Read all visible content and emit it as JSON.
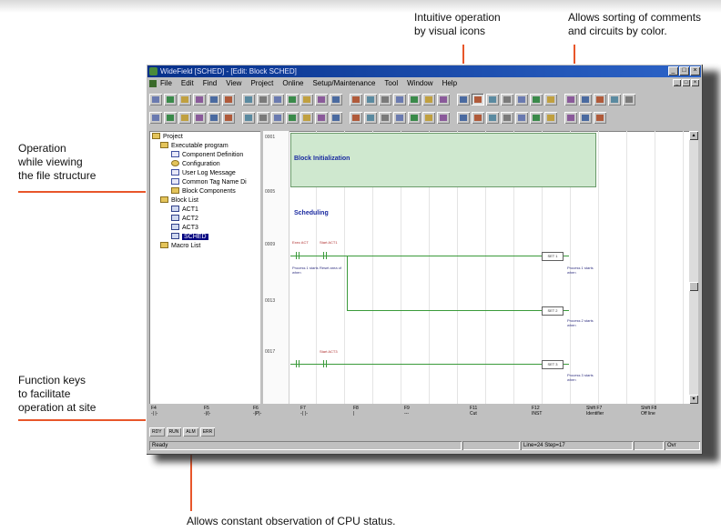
{
  "callouts": {
    "icons": "Intuitive operation\nby visual icons",
    "icons_l1": "Intuitive operation",
    "icons_l2": "by visual icons",
    "sorting_l1": "Allows sorting of comments",
    "sorting_l2": "and circuits by color.",
    "file_l1": "Operation",
    "file_l2": "while viewing",
    "file_l3": "the file structure",
    "fkeys_l1": "Function keys",
    "fkeys_l2": "to facilitate",
    "fkeys_l3": "operation at site",
    "cpu": "Allows constant observation of CPU status."
  },
  "colors": {
    "accent": "#e8562a",
    "title_bar": "#06308a",
    "block_bg": "#cfe8cf",
    "rail": "#3a9a3a"
  },
  "window": {
    "title": "WideField [SCHED] - [Edit: Block SCHED]",
    "menu": [
      "File",
      "Edit",
      "Find",
      "View",
      "Project",
      "Online",
      "Setup/Maintenance",
      "Tool",
      "Window",
      "Help"
    ]
  },
  "tree": {
    "items": [
      {
        "label": "Project",
        "icon": "folder-icon"
      },
      {
        "label": "Executable program",
        "icon": "folder-icon"
      },
      {
        "label": "Component Definition",
        "icon": "document-icon"
      },
      {
        "label": "Configuration",
        "icon": "gear-icon"
      },
      {
        "label": "User Log Message",
        "icon": "document-icon"
      },
      {
        "label": "Common Tag Name Di",
        "icon": "document-icon"
      },
      {
        "label": "Block Components",
        "icon": "folder-icon"
      },
      {
        "label": "Block List",
        "icon": "folder-icon"
      },
      {
        "label": "ACT1",
        "icon": "program-icon"
      },
      {
        "label": "ACT2",
        "icon": "program-icon"
      },
      {
        "label": "ACT3",
        "icon": "program-icon"
      },
      {
        "label": "SCHED",
        "icon": "program-icon"
      },
      {
        "label": "Macro List",
        "icon": "folder-icon"
      }
    ]
  },
  "ladder": {
    "block_title": "Block Initialization",
    "schedule_title": "Scheduling",
    "steps": [
      "0001",
      "0005",
      "0009",
      "0013",
      "0017"
    ],
    "comments": [
      "Exec ACT",
      "Start ACT1",
      "Process 1 starts when",
      "Reset area of",
      "Process 1 starts when",
      "Process 2 starts when",
      "Process 3 starts when",
      "Start ACT3"
    ],
    "coils": [
      "SET 1",
      "SET 2",
      "SET 3"
    ]
  },
  "function_keys": [
    {
      "key": "F4",
      "label": "-| |-"
    },
    {
      "key": "F5",
      "label": "-|/|-"
    },
    {
      "key": "F6",
      "label": "-|P|-"
    },
    {
      "key": "F7",
      "label": "-( )-"
    },
    {
      "key": "F8",
      "label": "|"
    },
    {
      "key": "F9",
      "label": "---"
    },
    {
      "key": "F11",
      "label": "Cut"
    },
    {
      "key": "F12",
      "label": "INST"
    },
    {
      "key": "Shift F7",
      "label": "Identifier"
    },
    {
      "key": "Shift F8",
      "label": "Off line"
    }
  ],
  "cpu_status": [
    "RDY",
    "RUN",
    "ALM",
    "ERR"
  ],
  "statusbar": {
    "ready": "Ready",
    "position": "Line=24 Step=17",
    "mode": "Ovr"
  }
}
